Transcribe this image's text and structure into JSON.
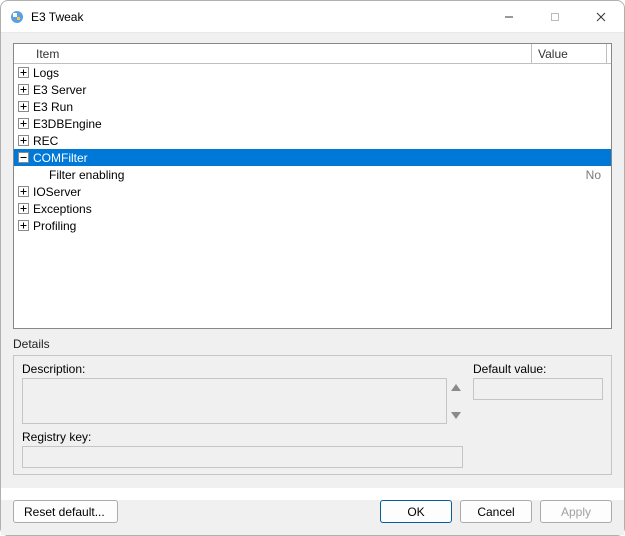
{
  "window": {
    "title": "E3 Tweak"
  },
  "tree": {
    "headers": {
      "item": "Item",
      "value": "Value"
    },
    "rows": [
      {
        "label": "Logs",
        "depth": 0,
        "expandable": true,
        "expanded": false,
        "value": "",
        "selected": false
      },
      {
        "label": "E3 Server",
        "depth": 0,
        "expandable": true,
        "expanded": false,
        "value": "",
        "selected": false
      },
      {
        "label": "E3 Run",
        "depth": 0,
        "expandable": true,
        "expanded": false,
        "value": "",
        "selected": false
      },
      {
        "label": "E3DBEngine",
        "depth": 0,
        "expandable": true,
        "expanded": false,
        "value": "",
        "selected": false
      },
      {
        "label": "REC",
        "depth": 0,
        "expandable": true,
        "expanded": false,
        "value": "",
        "selected": false
      },
      {
        "label": "COMFilter",
        "depth": 0,
        "expandable": true,
        "expanded": true,
        "value": "",
        "selected": true
      },
      {
        "label": "Filter enabling",
        "depth": 1,
        "expandable": false,
        "expanded": false,
        "value": "No",
        "selected": false
      },
      {
        "label": "IOServer",
        "depth": 0,
        "expandable": true,
        "expanded": false,
        "value": "",
        "selected": false
      },
      {
        "label": "Exceptions",
        "depth": 0,
        "expandable": true,
        "expanded": false,
        "value": "",
        "selected": false
      },
      {
        "label": "Profiling",
        "depth": 0,
        "expandable": true,
        "expanded": false,
        "value": "",
        "selected": false
      }
    ]
  },
  "details": {
    "title": "Details",
    "description_label": "Description:",
    "description_value": "",
    "default_label": "Default value:",
    "default_value": "",
    "registry_label": "Registry key:",
    "registry_value": ""
  },
  "buttons": {
    "reset": "Reset default...",
    "ok": "OK",
    "cancel": "Cancel",
    "apply": "Apply"
  }
}
